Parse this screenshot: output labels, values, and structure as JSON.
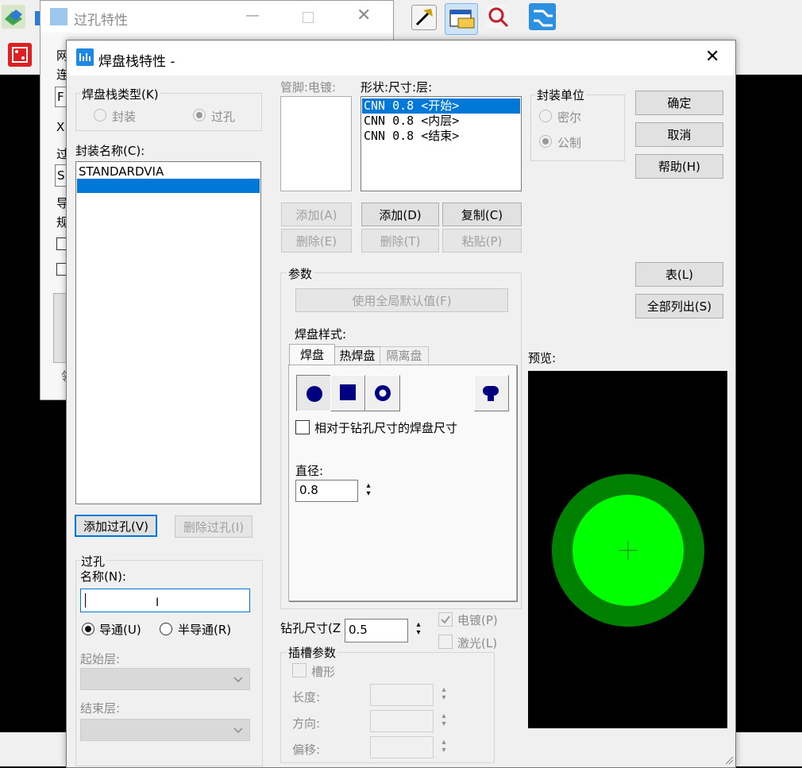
{
  "back_dialog": {
    "title": "过孔特性",
    "side_letters": [
      "网",
      "连",
      "F",
      "X",
      "过",
      "S",
      "导",
      "规",
      "领"
    ]
  },
  "dialog": {
    "title": "焊盘栈特性 -",
    "padstack_type": {
      "label": "焊盘栈类型(K)",
      "option_package": "封装",
      "option_via": "过孔",
      "selected": "过孔"
    },
    "package_name": {
      "label": "封装名称(C):",
      "items": [
        "STANDARDVIA",
        ""
      ],
      "selected_index": 1
    },
    "add_via_label": "添加过孔(V)",
    "delete_via_label": "删除过孔(I)",
    "via_group": {
      "label": "过孔",
      "name_label": "名称(N):",
      "name_value": "",
      "option_through": "导通(U)",
      "option_partial": "半导通(R)",
      "selected": "导通(U)",
      "start_layer_label": "起始层:",
      "end_layer_label": "结束层:"
    },
    "pin_plating_label": "管脚:电镀:",
    "shape_size_layer_label": "形状:尺寸:层:",
    "shape_items": [
      "CNN 0.8 <开始>",
      "CNN 0.8 <内层>",
      "CNN 0.8 <结束>"
    ],
    "shape_selected_index": 0,
    "pin_add_label": "添加(A)",
    "pin_delete_label": "删除(E)",
    "shape_add_label": "添加(D)",
    "shape_delete_label": "删除(T)",
    "copy_label": "复制(C)",
    "paste_label": "粘贴(P)",
    "params": {
      "label": "参数",
      "use_global_default_label": "使用全局默认值(F)",
      "pad_style_label": "焊盘样式:",
      "tabs": [
        "焊盘",
        "热焊盘",
        "隔离盘"
      ],
      "active_tab": "焊盘",
      "relative_size_label": "相对于钻孔尺寸的焊盘尺寸",
      "diameter_label": "直径:",
      "diameter_value": "0.8"
    },
    "drill_size_label": "钻孔尺寸(Z",
    "drill_size_value": "0.5",
    "plated_label": "电镀(P)",
    "laser_label": "激光(L)",
    "slot": {
      "label": "插槽参数",
      "slotted_label": "槽形",
      "length_label": "长度:",
      "orientation_label": "方向:",
      "offset_label": "偏移:"
    },
    "units": {
      "label": "封装单位",
      "option_mil": "密尔",
      "option_metric": "公制",
      "selected": "公制"
    },
    "ok_label": "确定",
    "cancel_label": "取消",
    "help_label": "帮助(H)",
    "list_label": "表(L)",
    "list_all_label": "全部列出(S)",
    "preview_label": "预览:",
    "colors": {
      "selection": "#0078d7",
      "preview_bg": "#000000",
      "pad_outer": "#008000",
      "pad_inner": "#00ff00",
      "pad_icon": "#000080"
    }
  }
}
